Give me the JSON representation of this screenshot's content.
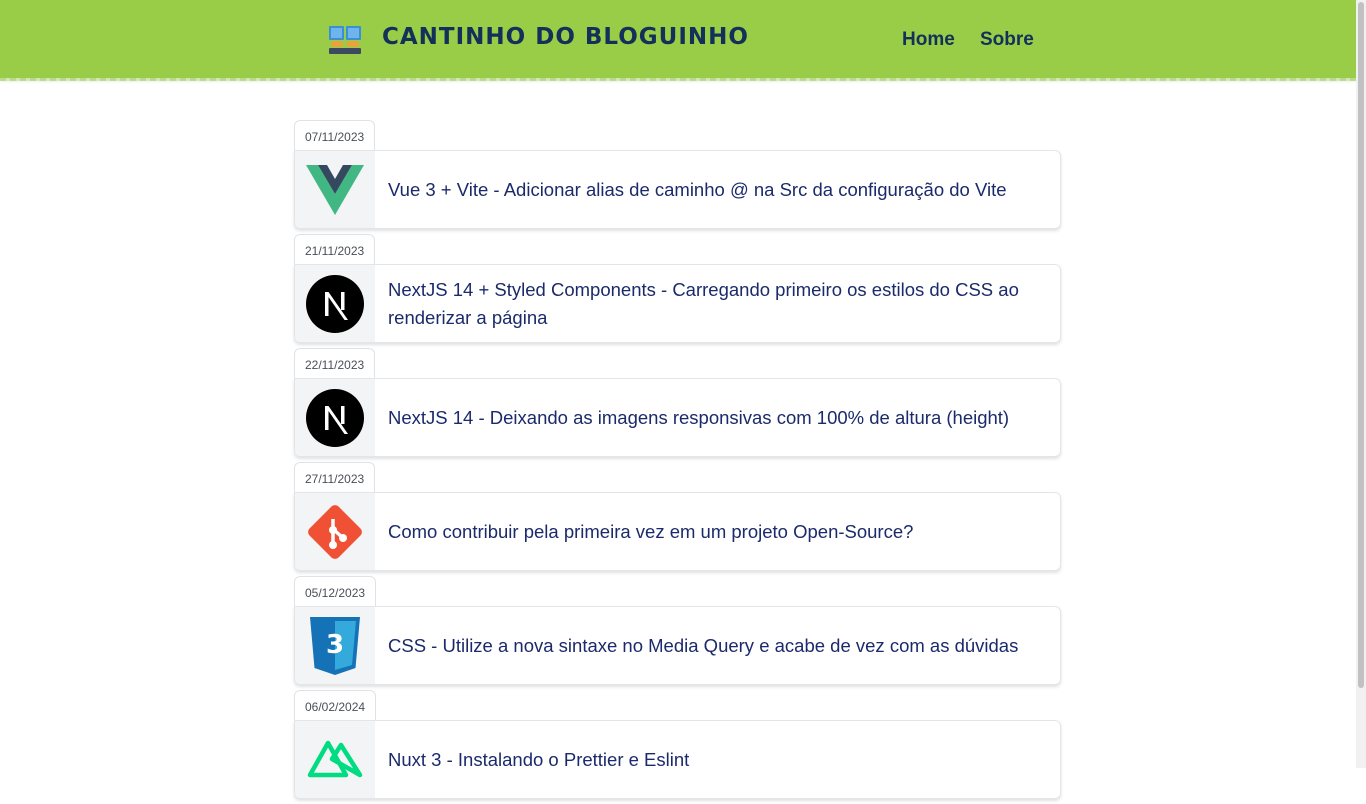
{
  "header": {
    "brand": "CANTINHO DO BLOGUINHO",
    "logo_icon": "book-icon",
    "nav": [
      {
        "label": "Home"
      },
      {
        "label": "Sobre"
      }
    ],
    "background_color": "#9acd47",
    "text_color": "#12305a"
  },
  "posts": [
    {
      "date": "07/11/2023",
      "icon": "vue-icon",
      "title": "Vue 3 + Vite - Adicionar alias de caminho @ na Src da configuração do Vite"
    },
    {
      "date": "21/11/2023",
      "icon": "nextjs-icon",
      "title": "NextJS 14 + Styled Components - Carregando primeiro os estilos do CSS ao renderizar a página"
    },
    {
      "date": "22/11/2023",
      "icon": "nextjs-icon",
      "title": "NextJS 14 - Deixando as imagens responsivas com 100% de altura (height)"
    },
    {
      "date": "27/11/2023",
      "icon": "git-icon",
      "title": "Como contribuir pela primeira vez em um projeto Open-Source?"
    },
    {
      "date": "05/12/2023",
      "icon": "css3-icon",
      "title": "CSS - Utilize a nova sintaxe no Media Query e acabe de vez com as dúvidas"
    },
    {
      "date": "06/02/2024",
      "icon": "nuxt-icon",
      "title": "Nuxt 3 - Instalando o Prettier e Eslint"
    }
  ],
  "colors": {
    "title_text": "#1b2a6b",
    "vue_green": "#41b883",
    "vue_dark": "#34495e",
    "git_orange": "#f05033",
    "css_blue": "#1572b6",
    "nuxt_green": "#00dc82"
  }
}
